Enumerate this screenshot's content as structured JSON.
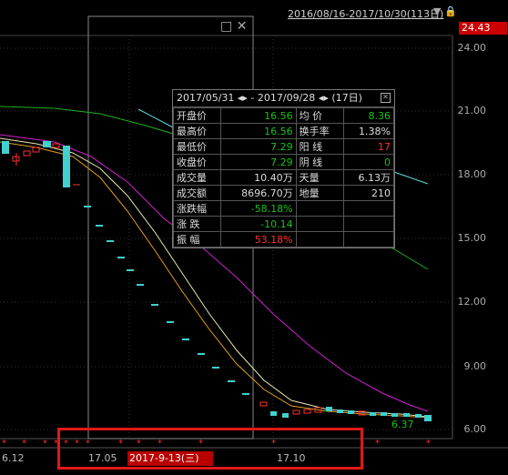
{
  "header": {
    "date_range": "2016/08/16-2017/10/30(113日)",
    "price_badge": "24.43"
  },
  "y_axis": [
    "24.00",
    "21.00",
    "18.00",
    "15.00",
    "12.00",
    "9.00",
    "6.00"
  ],
  "x_axis": [
    "6.12",
    "17.05",
    "17.10"
  ],
  "selected_date": "2017-9-13(三)",
  "low_label": "6.37",
  "window_controls": {
    "restore": "□",
    "close": "✕"
  },
  "popup": {
    "range": "2017/05/31 ◂▸ - 2017/09/28 ◂▸ (17日)",
    "rows": [
      {
        "l1": "开盘价",
        "v1": "16.56",
        "c1": "green",
        "l2": "均  价",
        "v2": "8.36",
        "c2": "green"
      },
      {
        "l1": "最高价",
        "v1": "16.56",
        "c1": "green",
        "l2": "换手率",
        "v2": "1.38%",
        "c2": "white"
      },
      {
        "l1": "最低价",
        "v1": "7.29",
        "c1": "green",
        "l2": "阳  线",
        "v2": "17",
        "c2": "red"
      },
      {
        "l1": "收盘价",
        "v1": "7.29",
        "c1": "green",
        "l2": "阴  线",
        "v2": "0",
        "c2": "green"
      },
      {
        "l1": "成交量",
        "v1": "10.40万",
        "c1": "white",
        "l2": "天量",
        "v2": "6.13万",
        "c2": "white"
      },
      {
        "l1": "成交额",
        "v1": "8696.70万",
        "c1": "white",
        "l2": "地量",
        "v2": "210",
        "c2": "white"
      },
      {
        "l1": "涨跌幅",
        "v1": "-58.18%",
        "c1": "green",
        "l2": "",
        "v2": "",
        "c2": "white"
      },
      {
        "l1": "涨  跌",
        "v1": "-10.14",
        "c1": "green",
        "l2": "",
        "v2": "",
        "c2": "white"
      },
      {
        "l1": "振  幅",
        "v1": "53.18%",
        "c1": "red",
        "l2": "",
        "v2": "",
        "c2": "white"
      }
    ]
  },
  "colors": {
    "ma_white": "#e8e8b0",
    "ma_yellow": "#e0a020",
    "ma_magenta": "#d020d0",
    "ma_green": "#20b020",
    "ma_cyan": "#60d8d8",
    "down": "#40d0d0",
    "up": "#ff3030"
  }
}
